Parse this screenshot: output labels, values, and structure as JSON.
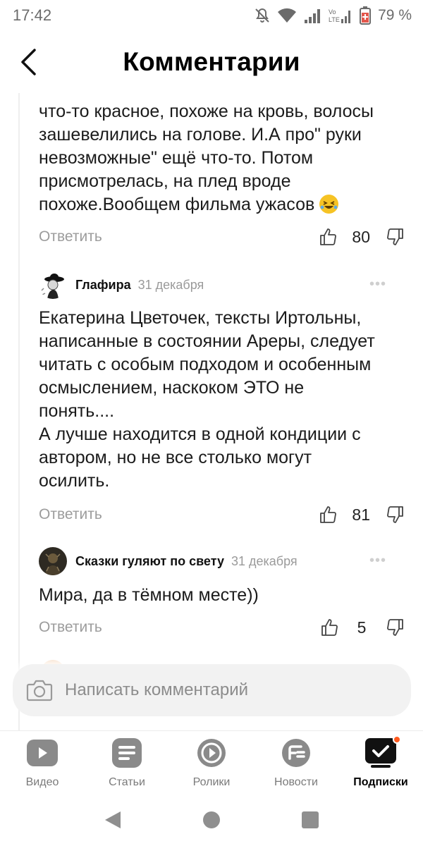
{
  "status_bar": {
    "time": "17:42",
    "battery": "79 %"
  },
  "header": {
    "title": "Комментарии",
    "back_icon": "chevron-left-icon"
  },
  "comments": [
    {
      "text": "что-то красное, похоже на кровь, волосы\nзашевелились на голове. И.А про\" руки\nневозможные\" ещё что-то. Потом\nприсмотрелась, на плед вроде\nпохоже.Вообщем фильма ужасов",
      "reply_label": "Ответить",
      "likes": "80"
    },
    {
      "author": "Глафира",
      "date": "31 декабря",
      "more": "•••",
      "text": "Екатерина Цветочек, тексты Иртольны,\nнаписанные в состоянии Ареры, следует\nчитать с особым подходом и особенным\nосмыслением, наскоком  ЭТО не\nпонять....\nА лучше находится в одной кондиции с\nавтором, но не все столько могут\nосилить.",
      "reply_label": "Ответить",
      "likes": "81"
    },
    {
      "author": "Сказки гуляют по свету",
      "date": "31 декабря",
      "more": "•••",
      "text": "Мира, да в тёмном месте))",
      "reply_label": "Ответить",
      "likes": "5"
    }
  ],
  "comment_input": {
    "placeholder": "Написать комментарий"
  },
  "bottom_nav": [
    {
      "label": "Видео",
      "icon": "video-play-icon"
    },
    {
      "label": "Статьи",
      "icon": "articles-icon"
    },
    {
      "label": "Ролики",
      "icon": "shorts-icon"
    },
    {
      "label": "Новости",
      "icon": "news-icon"
    },
    {
      "label": "Подписки",
      "icon": "subscriptions-icon",
      "active": true
    }
  ],
  "colors": {
    "accent_dot": "#ff5a1f",
    "muted_text": "#9c9c9c",
    "nav_icon": "#8a8a8a"
  }
}
